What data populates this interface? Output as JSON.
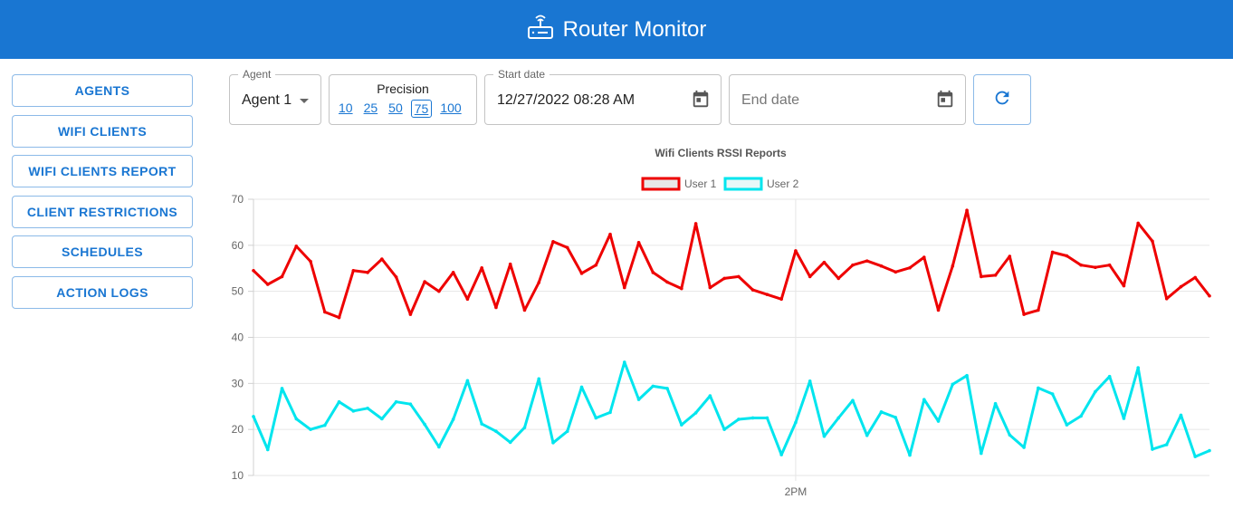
{
  "header": {
    "title": "Router Monitor",
    "icon": "router-icon"
  },
  "sidebar": {
    "items": [
      {
        "label": "AGENTS"
      },
      {
        "label": "WIFI CLIENTS"
      },
      {
        "label": "WIFI CLIENTS REPORT"
      },
      {
        "label": "CLIENT RESTRICTIONS"
      },
      {
        "label": "SCHEDULES"
      },
      {
        "label": "ACTION LOGS"
      }
    ]
  },
  "controls": {
    "agent": {
      "legend": "Agent",
      "value": "Agent 1"
    },
    "precision": {
      "label": "Precision",
      "options": [
        "10",
        "25",
        "50",
        "75",
        "100"
      ],
      "selected": "75"
    },
    "start_date": {
      "legend": "Start date",
      "value": "12/27/2022 08:28 AM"
    },
    "end_date": {
      "placeholder": "End date"
    },
    "refresh_icon": "refresh-icon"
  },
  "colors": {
    "primary": "#1976d2",
    "user1": "#ee0000",
    "user2": "#00e5ee"
  },
  "chart_data": {
    "type": "line",
    "title": "Wifi Clients RSSI Reports",
    "xlabel": "",
    "ylabel": "",
    "ylim": [
      10,
      70
    ],
    "yticks": [
      "10",
      "20",
      "30",
      "40",
      "50",
      "60",
      "70"
    ],
    "x_tick_labels": [
      {
        "index": 38,
        "label": "2PM"
      }
    ],
    "legend": "top",
    "grid": true,
    "series": [
      {
        "name": "User 1",
        "color": "#ee0000",
        "values": [
          54.5,
          51.5,
          53.2,
          59.8,
          56.5,
          45.5,
          44.3,
          54.5,
          54.1,
          57.0,
          53.1,
          45.0,
          52.1,
          50.0,
          54.1,
          48.3,
          55.1,
          46.5,
          55.9,
          45.9,
          51.9,
          60.8,
          59.5,
          53.9,
          55.7,
          62.4,
          50.8,
          60.6,
          54.1,
          52.0,
          50.6,
          64.7,
          50.8,
          52.8,
          53.2,
          50.3,
          49.3,
          48.3,
          58.8,
          53.2,
          56.3,
          52.8,
          55.7,
          56.6,
          55.5,
          54.2,
          55.1,
          57.4,
          45.9,
          55.5,
          67.6,
          53.2,
          53.5,
          57.6,
          45.0,
          45.9,
          58.5,
          57.7,
          55.7,
          55.2,
          55.7,
          51.2,
          64.8,
          60.9,
          48.4,
          51.0,
          53.0,
          49.0
        ]
      },
      {
        "name": "User 2",
        "color": "#00e5ee",
        "values": [
          22.8,
          15.6,
          28.9,
          22.3,
          20.0,
          20.9,
          26.0,
          24.0,
          24.6,
          22.3,
          26.0,
          25.5,
          21.1,
          16.2,
          22.2,
          30.6,
          21.2,
          19.6,
          17.2,
          20.4,
          31.0,
          17.1,
          19.6,
          29.2,
          22.5,
          23.7,
          34.6,
          26.5,
          29.4,
          28.9,
          21.0,
          23.6,
          27.3,
          20.0,
          22.2,
          22.5,
          22.5,
          14.5,
          21.5,
          30.5,
          18.5,
          22.5,
          26.3,
          18.7,
          23.8,
          22.6,
          14.4,
          26.5,
          21.8,
          29.8,
          31.7,
          14.8,
          25.6,
          18.8,
          16.1,
          29.0,
          27.7,
          21.0,
          22.9,
          28.2,
          31.5,
          22.4,
          33.4,
          15.7,
          16.7,
          23.1,
          14.1,
          15.4
        ]
      }
    ]
  }
}
